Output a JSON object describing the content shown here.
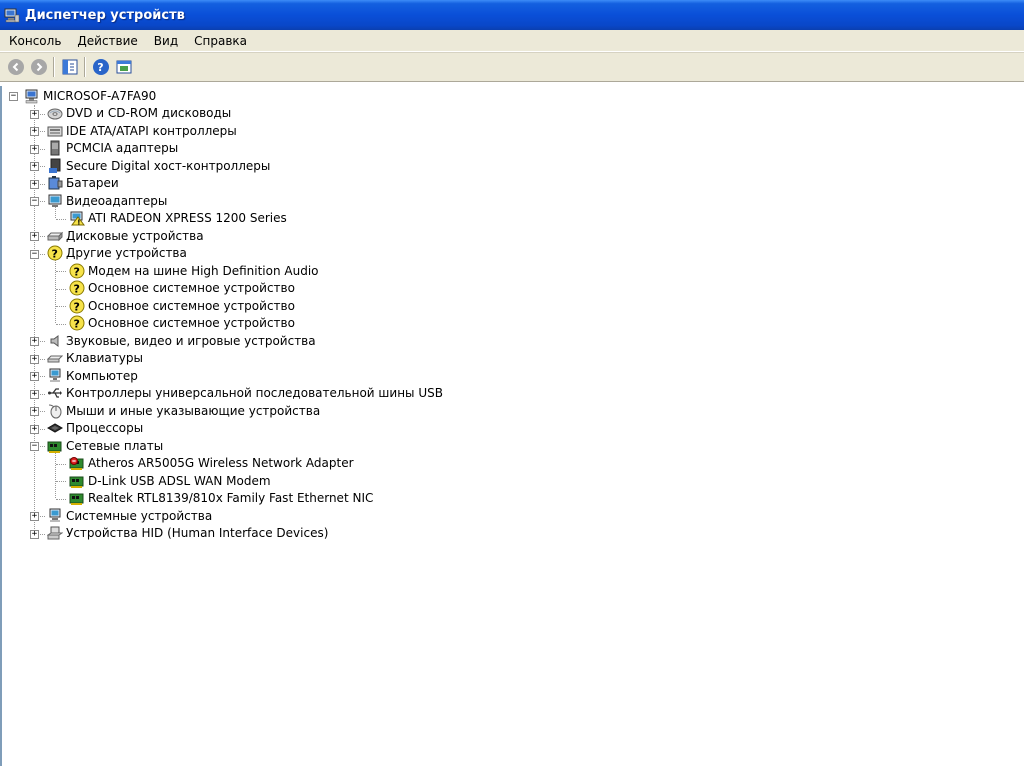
{
  "window": {
    "title": "Диспетчер устройств"
  },
  "menu": [
    "Консоль",
    "Действие",
    "Вид",
    "Справка"
  ],
  "toolbar": [
    {
      "name": "back-icon",
      "glyph": "◀"
    },
    {
      "name": "forward-icon",
      "glyph": "▶"
    },
    {
      "name": "show-hide-tree-icon",
      "glyph": ""
    },
    {
      "name": "help-icon",
      "glyph": "?"
    },
    {
      "name": "properties-icon",
      "glyph": ""
    }
  ],
  "tree": [
    {
      "label": "MICROSOF-A7FA90",
      "level": 0,
      "state": "expanded",
      "icon": "computer-icon"
    },
    {
      "label": "DVD и CD-ROM дисководы",
      "level": 1,
      "state": "collapsed",
      "icon": "cdrom-icon"
    },
    {
      "label": "IDE ATA/ATAPI контроллеры",
      "level": 1,
      "state": "collapsed",
      "icon": "ide-controller-icon"
    },
    {
      "label": "PCMCIA адаптеры",
      "level": 1,
      "state": "collapsed",
      "icon": "pcmcia-icon"
    },
    {
      "label": "Secure Digital хост-контроллеры",
      "level": 1,
      "state": "collapsed",
      "icon": "sd-host-icon"
    },
    {
      "label": "Батареи",
      "level": 1,
      "state": "collapsed",
      "icon": "battery-icon"
    },
    {
      "label": "Видеоадаптеры",
      "level": 1,
      "state": "expanded",
      "icon": "display-adapter-icon"
    },
    {
      "label": "ATI RADEON XPRESS 1200 Series",
      "level": 2,
      "state": "leaf",
      "icon": "display-warning-icon"
    },
    {
      "label": "Дисковые устройства",
      "level": 1,
      "state": "collapsed",
      "icon": "disk-drive-icon"
    },
    {
      "label": "Другие устройства",
      "level": 1,
      "state": "expanded",
      "icon": "unknown-device-icon"
    },
    {
      "label": "Модем на шине High Definition Audio",
      "level": 2,
      "state": "leaf",
      "icon": "unknown-device-icon"
    },
    {
      "label": "Основное системное устройство",
      "level": 2,
      "state": "leaf",
      "icon": "unknown-device-icon"
    },
    {
      "label": "Основное системное устройство",
      "level": 2,
      "state": "leaf",
      "icon": "unknown-device-icon"
    },
    {
      "label": "Основное системное устройство",
      "level": 2,
      "state": "leaf",
      "icon": "unknown-device-icon"
    },
    {
      "label": "Звуковые, видео и игровые устройства",
      "level": 1,
      "state": "collapsed",
      "icon": "speaker-icon"
    },
    {
      "label": "Клавиатуры",
      "level": 1,
      "state": "collapsed",
      "icon": "keyboard-icon"
    },
    {
      "label": "Компьютер",
      "level": 1,
      "state": "collapsed",
      "icon": "computer-monitor-icon"
    },
    {
      "label": "Контроллеры универсальной последовательной шины USB",
      "level": 1,
      "state": "collapsed",
      "icon": "usb-icon"
    },
    {
      "label": "Мыши и иные указывающие устройства",
      "level": 1,
      "state": "collapsed",
      "icon": "mouse-icon"
    },
    {
      "label": "Процессоры",
      "level": 1,
      "state": "collapsed",
      "icon": "processor-icon"
    },
    {
      "label": "Сетевые платы",
      "level": 1,
      "state": "expanded",
      "icon": "network-card-icon"
    },
    {
      "label": "Atheros AR5005G Wireless Network Adapter",
      "level": 2,
      "state": "leaf",
      "icon": "network-card-disabled-icon"
    },
    {
      "label": "D-Link USB ADSL WAN Modem",
      "level": 2,
      "state": "leaf",
      "icon": "network-card-icon"
    },
    {
      "label": "Realtek RTL8139/810x Family Fast Ethernet NIC",
      "level": 2,
      "state": "leaf",
      "icon": "network-card-icon"
    },
    {
      "label": "Системные устройства",
      "level": 1,
      "state": "collapsed",
      "icon": "system-device-icon"
    },
    {
      "label": "Устройства HID (Human Interface Devices)",
      "level": 1,
      "state": "collapsed",
      "icon": "hid-icon"
    }
  ]
}
